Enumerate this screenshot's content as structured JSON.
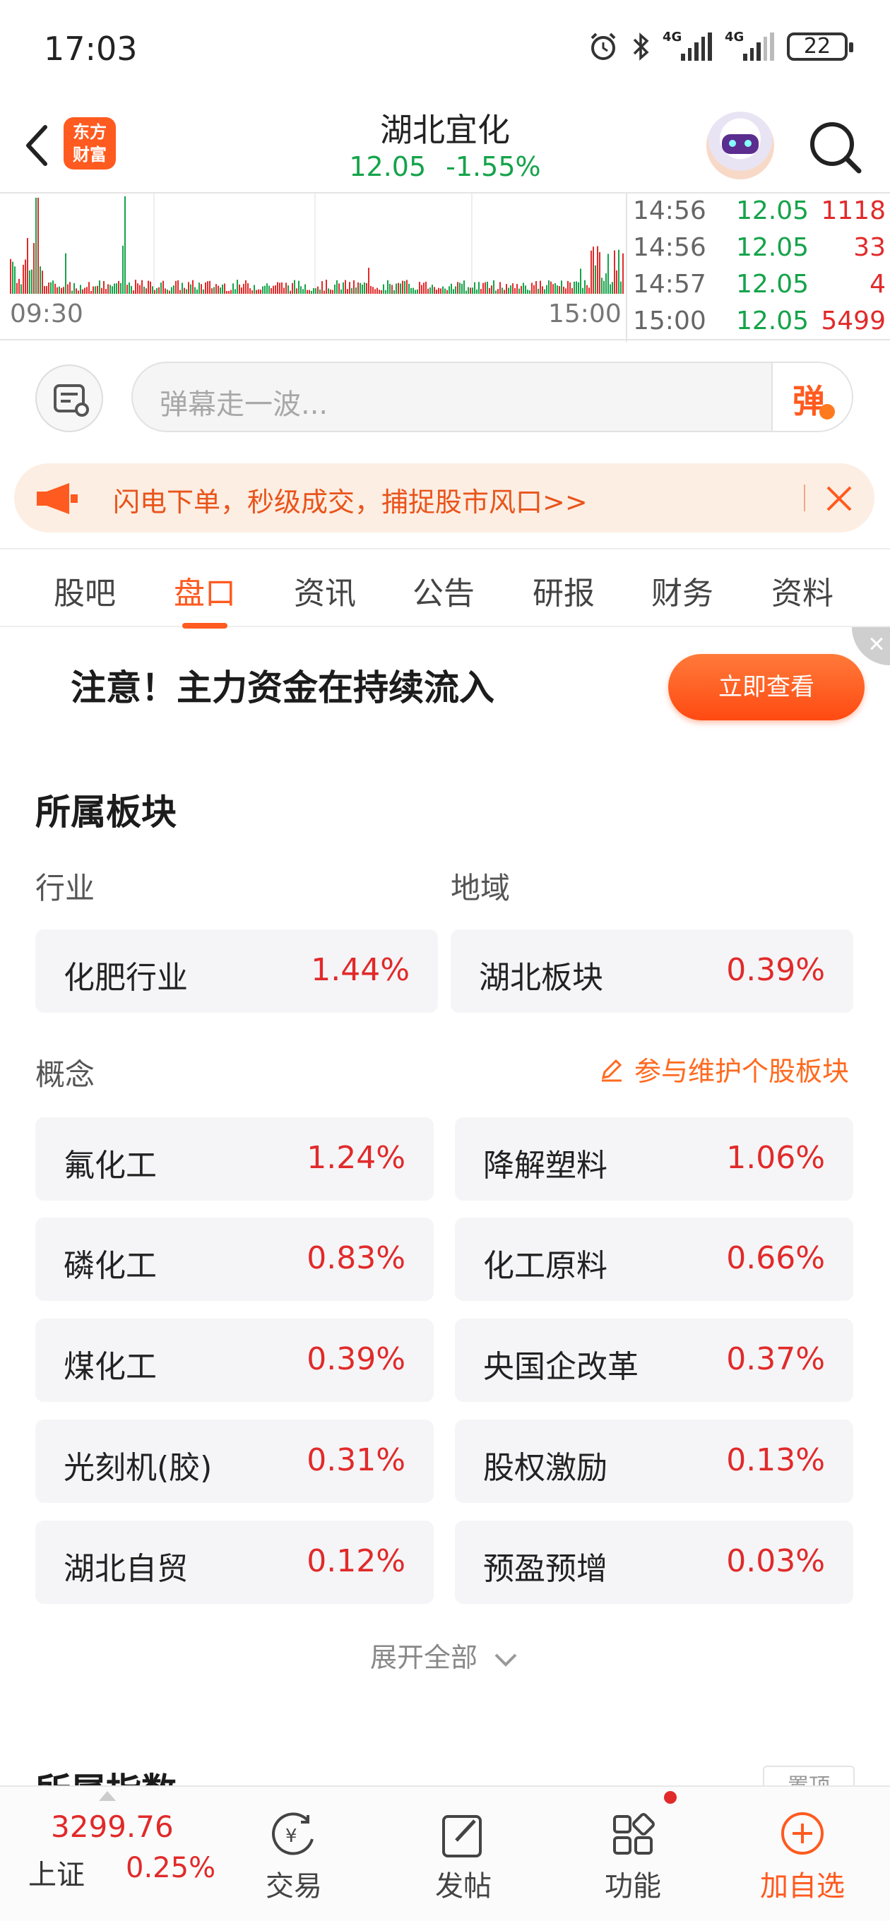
{
  "status_bar": {
    "time": "17:03",
    "battery": "22",
    "net1": "4G",
    "net2": "4G"
  },
  "header": {
    "logo_line1": "东方",
    "logo_line2": "财富",
    "title": "湖北宜化",
    "price": "12.05",
    "change_pct": "-1.55%"
  },
  "mini_chart": {
    "start_time": "09:30",
    "end_time": "15:00",
    "ticks": [
      {
        "time": "14:56",
        "price": "12.05",
        "vol": "1118"
      },
      {
        "time": "14:56",
        "price": "12.05",
        "vol": "33"
      },
      {
        "time": "14:57",
        "price": "12.05",
        "vol": "4"
      },
      {
        "time": "15:00",
        "price": "12.05",
        "vol": "5499"
      }
    ]
  },
  "danmaku": {
    "placeholder": "弹幕走一波...",
    "button": "弹"
  },
  "promo": {
    "text": "闪电下单，秒级成交，捕捉股市风口>>"
  },
  "tabs": [
    "股吧",
    "盘口",
    "资讯",
    "公告",
    "研报",
    "财务",
    "资料"
  ],
  "active_tab": "盘口",
  "banner": {
    "text": "注意！主力资金在持续流入",
    "button": "立即查看"
  },
  "sectors": {
    "title": "所属板块",
    "industry_label": "行业",
    "region_label": "地域",
    "industry": {
      "name": "化肥行业",
      "pct": "1.44%"
    },
    "region": {
      "name": "湖北板块",
      "pct": "0.39%"
    },
    "concept_label": "概念",
    "maintain_link": "参与维护个股板块",
    "concepts": [
      {
        "name": "氟化工",
        "pct": "1.24%"
      },
      {
        "name": "降解塑料",
        "pct": "1.06%"
      },
      {
        "name": "磷化工",
        "pct": "0.83%"
      },
      {
        "name": "化工原料",
        "pct": "0.66%"
      },
      {
        "name": "煤化工",
        "pct": "0.39%"
      },
      {
        "name": "央国企改革",
        "pct": "0.37%"
      },
      {
        "name": "光刻机(胶)",
        "pct": "0.31%"
      },
      {
        "name": "股权激励",
        "pct": "0.13%"
      },
      {
        "name": "湖北自贸",
        "pct": "0.12%"
      },
      {
        "name": "预盈预增",
        "pct": "0.03%"
      }
    ],
    "expand": "展开全部"
  },
  "next_section": {
    "title": "所属指数",
    "pill": "置顶"
  },
  "bottom_bar": {
    "index_value": "3299.76",
    "index_name": "上证",
    "index_pct": "0.25%",
    "nav": [
      "交易",
      "发帖",
      "功能",
      "加自选"
    ]
  },
  "colors": {
    "accent": "#ff5a1f",
    "up": "#e12a2a",
    "down": "#15a34a"
  }
}
